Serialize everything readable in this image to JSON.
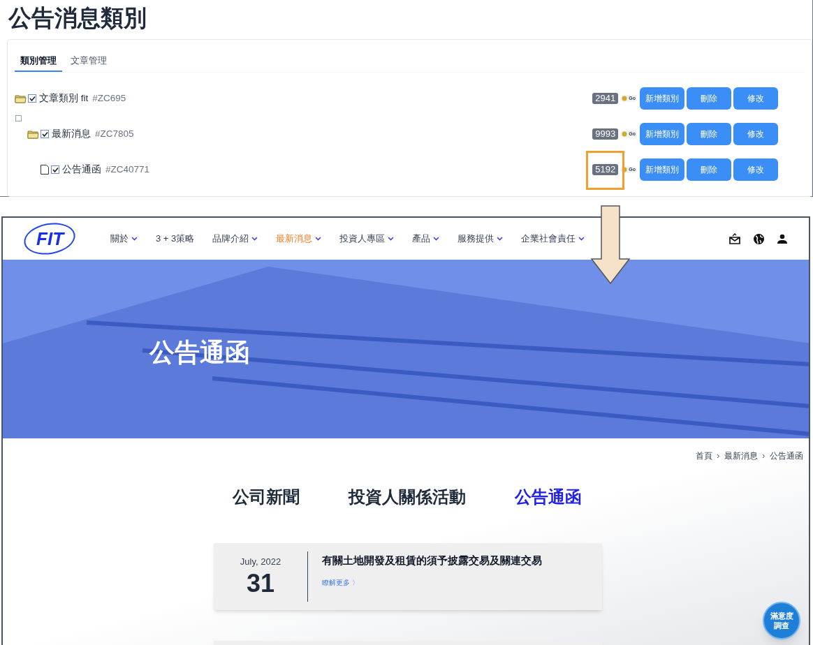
{
  "admin": {
    "title": "公告消息類別",
    "tabs": [
      {
        "label": "類別管理",
        "selected": true
      },
      {
        "label": "文章管理",
        "selected": false
      }
    ],
    "tree": [
      {
        "kind": "folder",
        "checked": true,
        "name": "文章類別 fit",
        "code": "#ZC695",
        "count": "2941",
        "go": "Go",
        "actions": [
          "新增類別",
          "刪除",
          "修改"
        ],
        "highlighted": false,
        "children": [
          {
            "kind": "folder",
            "checked": true,
            "name": "最新消息",
            "code": "#ZC7805",
            "count": "9993",
            "go": "Go",
            "actions": [
              "新增類別",
              "刪除",
              "修改"
            ],
            "highlighted": false,
            "children": [
              {
                "kind": "file",
                "checked": true,
                "name": "公告通函",
                "code": "#ZC40771",
                "count": "5192",
                "go": "Go",
                "actions": [
                  "新增類別",
                  "刪除",
                  "修改"
                ],
                "highlighted": true
              }
            ]
          }
        ]
      }
    ]
  },
  "site": {
    "logo": "FIT",
    "nav": [
      {
        "label": "關於",
        "dropdown": true,
        "selected": false
      },
      {
        "label": "3 + 3策略",
        "dropdown": false,
        "selected": false
      },
      {
        "label": "品牌介紹",
        "dropdown": true,
        "selected": false
      },
      {
        "label": "最新消息",
        "dropdown": true,
        "selected": true
      },
      {
        "label": "投資人專區",
        "dropdown": true,
        "selected": false
      },
      {
        "label": "產品",
        "dropdown": true,
        "selected": false
      },
      {
        "label": "服務提供",
        "dropdown": true,
        "selected": false
      },
      {
        "label": "企業社會責任",
        "dropdown": true,
        "selected": false
      }
    ],
    "hero_title": "公告通函",
    "breadcrumb": [
      "首頁",
      "最新消息",
      "公告通函"
    ],
    "tabs": [
      {
        "label": "公司新聞",
        "selected": false
      },
      {
        "label": "投資人關係活動",
        "selected": false
      },
      {
        "label": "公告通函",
        "selected": true
      }
    ],
    "posts": [
      {
        "month": "July, 2022",
        "day": "31",
        "title": "有關土地開發及租賃的須予披露交易及關連交易",
        "more": "瞭解更多 〉"
      }
    ],
    "survey": "滿意度調查"
  }
}
